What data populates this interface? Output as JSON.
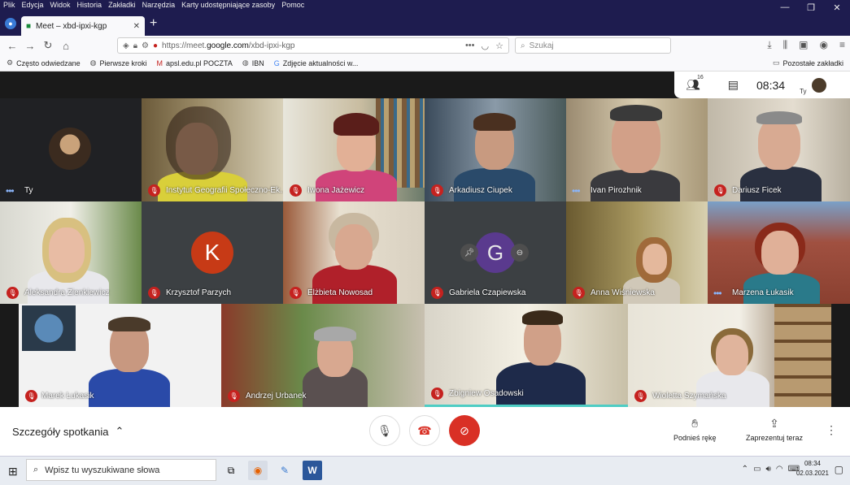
{
  "browser": {
    "menu": [
      "Plik",
      "Edycja",
      "Widok",
      "Historia",
      "Zakładki",
      "Narzędzia",
      "Karty udostępniające zasoby",
      "Pomoc"
    ],
    "tab_title": "Meet – xbd-ipxi-kgp",
    "url_prefix": "https://meet.",
    "url_domain": "google.com",
    "url_path": "/xbd-ipxi-kgp",
    "search_placeholder": "Szukaj",
    "bookmarks": [
      "Często odwiedzane",
      "Pierwsze kroki",
      "apsl.edu.pl POCZTA",
      "IBN",
      "Zdjęcie aktualności w..."
    ],
    "other_bookmarks": "Pozostałe zakładki"
  },
  "meet": {
    "participants_count": "16",
    "time": "08:34",
    "self_label": "Ty",
    "tiles": [
      {
        "name": "Ty",
        "status": "speaking"
      },
      {
        "name": "Instytut Geografii Społeczno-Ek...",
        "status": "muted"
      },
      {
        "name": "Iwona Jażewicz",
        "status": "muted"
      },
      {
        "name": "Arkadiusz Ciupek",
        "status": "muted"
      },
      {
        "name": "Ivan Pirozhnik",
        "status": "speaking"
      },
      {
        "name": "Dariusz Ficek",
        "status": "muted"
      },
      {
        "name": "Aleksandra Zienkiewicz",
        "status": "muted"
      },
      {
        "name": "Krzysztof Parzych",
        "status": "muted",
        "initial": "K"
      },
      {
        "name": "Elżbieta Nowosad",
        "status": "muted"
      },
      {
        "name": "Gabriela Czapiewska",
        "status": "muted",
        "initial": "G"
      },
      {
        "name": "Anna Wiśniewska",
        "status": "muted"
      },
      {
        "name": "Marzena Łukasik",
        "status": "speaking"
      },
      {
        "name": "Marek Łukasik",
        "status": "muted"
      },
      {
        "name": "Andrzej Urbanek",
        "status": "muted"
      },
      {
        "name": "Zbigniew Osadowski",
        "status": "muted"
      },
      {
        "name": "Wioletta Szymańska",
        "status": "muted"
      }
    ],
    "details_label": "Szczegóły spotkania",
    "raise_hand": "Podnieś rękę",
    "present_now": "Zaprezentuj teraz"
  },
  "taskbar": {
    "search_placeholder": "Wpisz tu wyszukiwane słowa",
    "time": "08:34",
    "date": "02.03.2021"
  },
  "colors": {
    "muted": "#c5221f",
    "hangup": "#d93025",
    "speaking": "#8ab4f8"
  }
}
